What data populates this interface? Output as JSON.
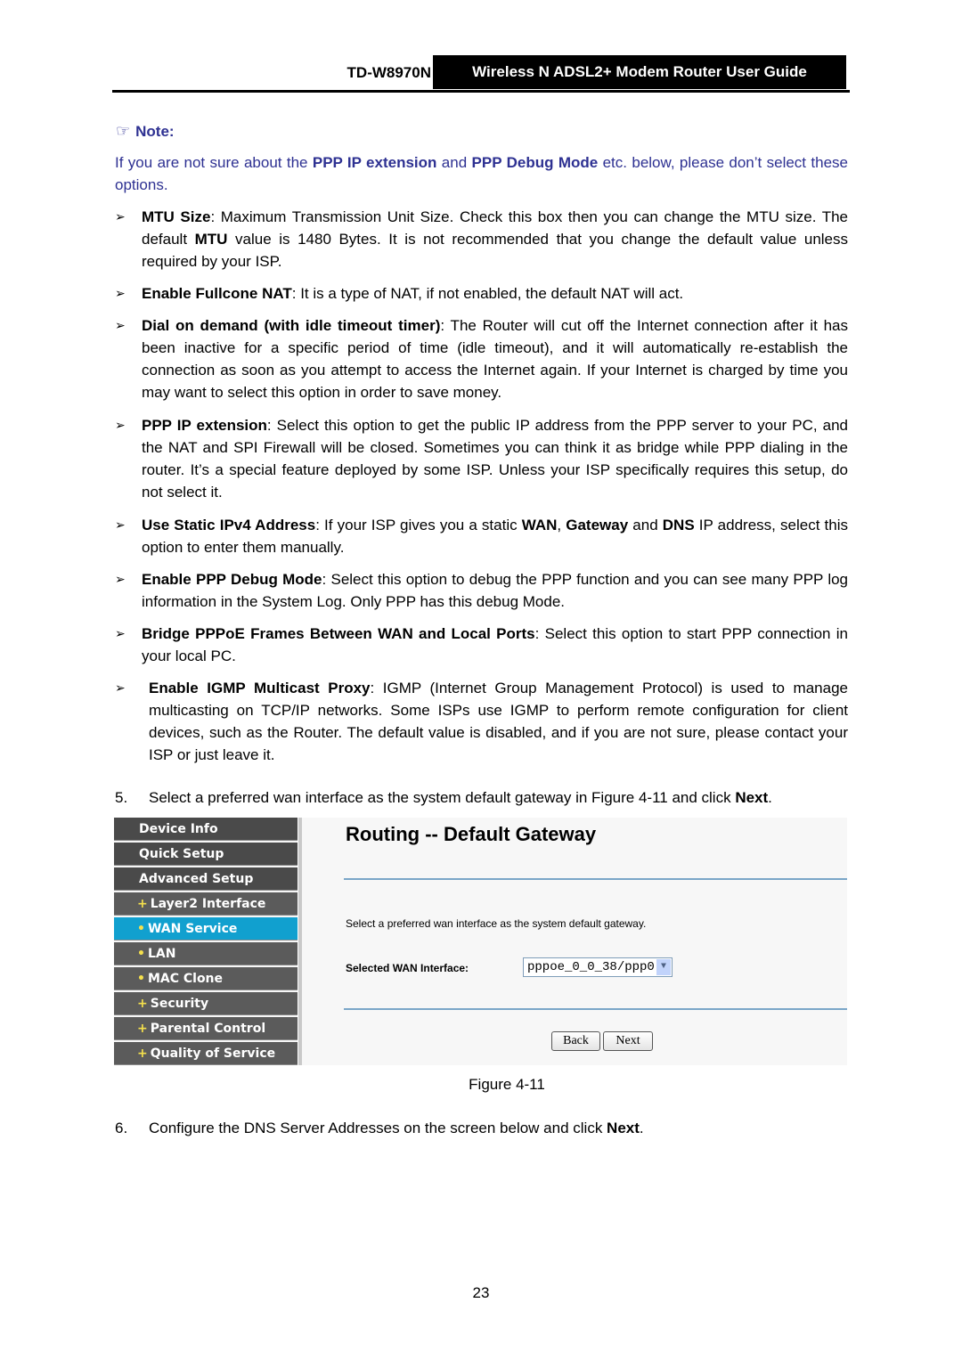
{
  "header": {
    "model": "TD-W8970N",
    "guide_title": "Wireless N ADSL2+ Modem Router User Guide"
  },
  "note": {
    "icon": "pointing-hand-icon",
    "label": "Note:",
    "text_1": "If you are not sure about the ",
    "bold_1": "PPP IP extension",
    "text_2": " and ",
    "bold_2": "PPP Debug Mode",
    "text_3": " etc. below, please don’t select these options."
  },
  "bullets": [
    {
      "term": "MTU Size",
      "text_a": ": Maximum Transmission Unit Size. Check this box then you can change the MTU size. The default ",
      "bold_b": "MTU",
      "text_c": " value is 1480 Bytes. It is not recommended that you change the default value unless required by your ISP."
    },
    {
      "term": "Enable Fullcone NAT",
      "text_a": ": It is a type of NAT, if not enabled, the default NAT will act."
    },
    {
      "term": "Dial on demand (with idle timeout timer)",
      "text_a": ": The Router will cut off the Internet connection after it has been inactive for a specific period of time (idle timeout), and it will automatically re-establish the connection as soon as you attempt to access the Internet again. If your Internet is charged by time you may want to select this option in order to save money."
    },
    {
      "term": "PPP IP extension",
      "text_a": ": Select this option to get the public IP address from the PPP server to your PC, and the NAT and SPI Firewall will be closed. Sometimes you can think it as bridge while PPP dialing in the router. It’s a special feature deployed by some ISP. Unless your ISP specifically requires this setup, do not select it."
    },
    {
      "term": "Use Static IPv4 Address",
      "text_a": ": If your ISP gives you a static ",
      "bold_b": "WAN",
      "text_c": ", ",
      "bold_d": "Gateway",
      "text_e": " and ",
      "bold_f": "DNS",
      "text_g": " IP address, select this option to enter them manually."
    },
    {
      "term": "Enable PPP Debug Mode",
      "text_a": ": Select this option to debug the PPP function and you can see many PPP log information in the System Log. Only PPP has this debug Mode."
    },
    {
      "term": "Bridge PPPoE Frames Between WAN and Local Ports",
      "text_a": ": Select this option to start PPP connection in your local PC."
    },
    {
      "term": "Enable IGMP Multicast Proxy",
      "text_a": ": IGMP (Internet Group Management Protocol) is used to manage multicasting on TCP/IP networks. Some ISPs use IGMP to perform remote configuration for client devices, such as the Router. The default value is disabled, and if you are not sure, please contact your ISP or just leave it."
    }
  ],
  "steps": [
    {
      "num": "5.",
      "text": "Select a preferred wan interface as the system default gateway in Figure 4-11 and click ",
      "bold": "Next",
      "end": "."
    },
    {
      "num": "6.",
      "text": "Configure the DNS Server Addresses on the screen below and click ",
      "bold": "Next",
      "end": "."
    }
  ],
  "figure": {
    "menu": [
      {
        "label": "Device Info",
        "sub": false,
        "active": false
      },
      {
        "label": "Quick Setup",
        "sub": false,
        "active": false
      },
      {
        "label": "Advanced Setup",
        "sub": false,
        "active": false
      },
      {
        "label": "Layer2 Interface",
        "sub": true,
        "active": false
      },
      {
        "label": "WAN Service",
        "sub": true,
        "active": true
      },
      {
        "label": "LAN",
        "sub": true,
        "active": false
      },
      {
        "label": "MAC Clone",
        "sub": true,
        "active": false
      },
      {
        "label": "Security",
        "sub": true,
        "active": false
      },
      {
        "label": "Parental Control",
        "sub": true,
        "active": false
      },
      {
        "label": "Quality of Service",
        "sub": true,
        "active": false
      }
    ],
    "page_title": "Routing -- Default Gateway",
    "description": "Select a preferred wan interface as the system default gateway.",
    "wan_label": "Selected WAN Interface:",
    "wan_value": "pppoe_0_0_38/ppp0",
    "back_label": "Back",
    "next_label": "Next",
    "caption": "Figure 4-11"
  },
  "page_number": "23"
}
